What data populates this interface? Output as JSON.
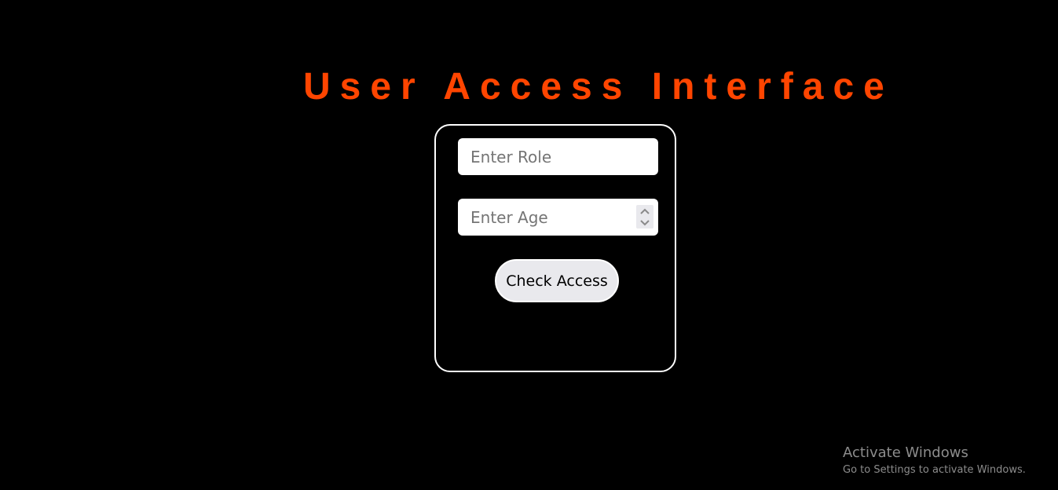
{
  "page": {
    "title": "User Access Interface",
    "title_color": "#ff4500",
    "background_color": "#000000"
  },
  "form": {
    "role_input": {
      "value": "",
      "placeholder": "Enter Role"
    },
    "age_input": {
      "value": "",
      "placeholder": "Enter Age"
    },
    "check_button_label": "Check Access",
    "spinner_icons": [
      "chevron-up-icon",
      "chevron-down-icon"
    ]
  },
  "watermark": {
    "title": "Activate Windows",
    "subtitle": "Go to Settings to activate Windows."
  }
}
